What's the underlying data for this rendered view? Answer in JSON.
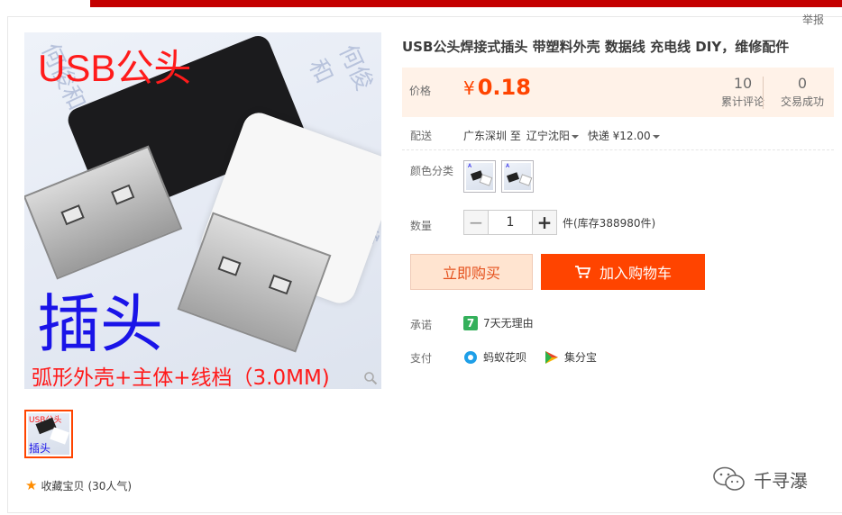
{
  "header": {
    "report_label": "举报"
  },
  "gallery": {
    "overlay_title": "USB公头",
    "overlay_big": "插头",
    "overlay_caption": "弧形外壳+主体+线档（3.0MM)",
    "watermark_text": "何俊和",
    "thumb_title": "USB公头",
    "thumb_big": "插头"
  },
  "favorite": {
    "label": "收藏宝贝",
    "count": "(30人气)"
  },
  "product": {
    "title": "USB公头焊接式插头 带塑料外壳 数据线 充电线 DIY，维修配件",
    "price_label": "价格",
    "currency": "¥",
    "price": "0.18",
    "reviews_count": "10",
    "reviews_label": "累计评论",
    "sales_count": "0",
    "sales_label": "交易成功",
    "shipping_label": "配送",
    "ship_from": "广东深圳 至",
    "ship_to": "辽宁沈阳",
    "ship_method": "快递 ¥12.00",
    "color_label": "颜色分类",
    "quantity_label": "数量",
    "quantity_value": "1",
    "stock_text": "件(库存388980件)",
    "buy_now_label": "立即购买",
    "add_cart_label": "加入购物车",
    "promise_label": "承诺",
    "promise_icon_text": "7",
    "promise_text": "7天无理由",
    "payment_label": "支付",
    "pay_method_1": "蚂蚁花呗",
    "pay_method_2": "集分宝"
  },
  "brand_watermark": {
    "text": "千寻瀑"
  },
  "colors": {
    "accent": "#ff4400",
    "price_bg": "#fff2e8",
    "topbar": "#c40000"
  }
}
